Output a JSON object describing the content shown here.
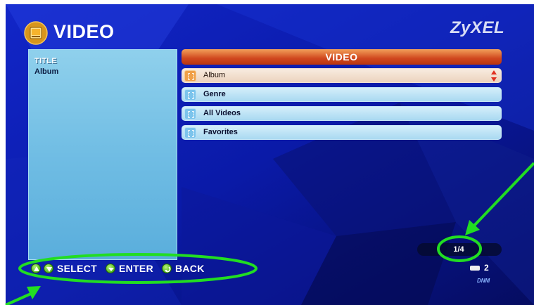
{
  "header": {
    "title": "VIDEO",
    "icon": "video-folder-icon",
    "brand": "ZyXEL"
  },
  "info_panel": {
    "heading": "TITLE",
    "value": "Album"
  },
  "menu": {
    "header": "VIDEO",
    "items": [
      {
        "label": "Album",
        "selected": true,
        "icon": "folder-icon"
      },
      {
        "label": "Genre",
        "selected": false,
        "icon": "folder-icon"
      },
      {
        "label": "All Videos",
        "selected": false,
        "icon": "folder-icon"
      },
      {
        "label": "Favorites",
        "selected": false,
        "icon": "folder-icon"
      }
    ]
  },
  "page_indicator": "1/4",
  "hints": {
    "select": "SELECT",
    "enter": "ENTER",
    "back": "BACK"
  },
  "status": {
    "storage_count": "2",
    "dlna": "DNM"
  },
  "colors": {
    "background": "#0a1a9a",
    "menu_header": "#d0461e",
    "menu_item": "#a9d9f1",
    "selected_item": "#ecd3be",
    "annotation": "#22dd22",
    "hint_button": "#4eb81c"
  }
}
